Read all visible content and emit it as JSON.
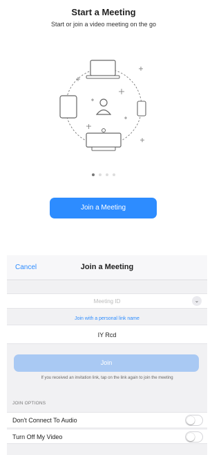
{
  "onboarding": {
    "title": "Start a Meeting",
    "subtitle": "Start or join a video meeting on the go",
    "illustration_icon": "meeting-devices-illustration",
    "page_indicator": {
      "total": 4,
      "active": 1
    },
    "join_button_label": "Join a Meeting"
  },
  "sheet": {
    "cancel_label": "Cancel",
    "title": "Join a Meeting",
    "meeting_id_placeholder": "Meeting ID",
    "personal_link_label": "Join with a personal link name",
    "name_value": "IY Rcd",
    "join_label": "Join",
    "hint": "If you received an invitation link, tap on the link again to join the meeting",
    "options_header": "JOIN OPTIONS",
    "options": [
      {
        "label": "Don't Connect To Audio",
        "on": false
      },
      {
        "label": "Turn Off My Video",
        "on": false
      }
    ]
  },
  "colors": {
    "accent": "#2d8cff",
    "accent_disabled": "#a9c9f3",
    "sheet_bg": "#f1f1f3"
  }
}
